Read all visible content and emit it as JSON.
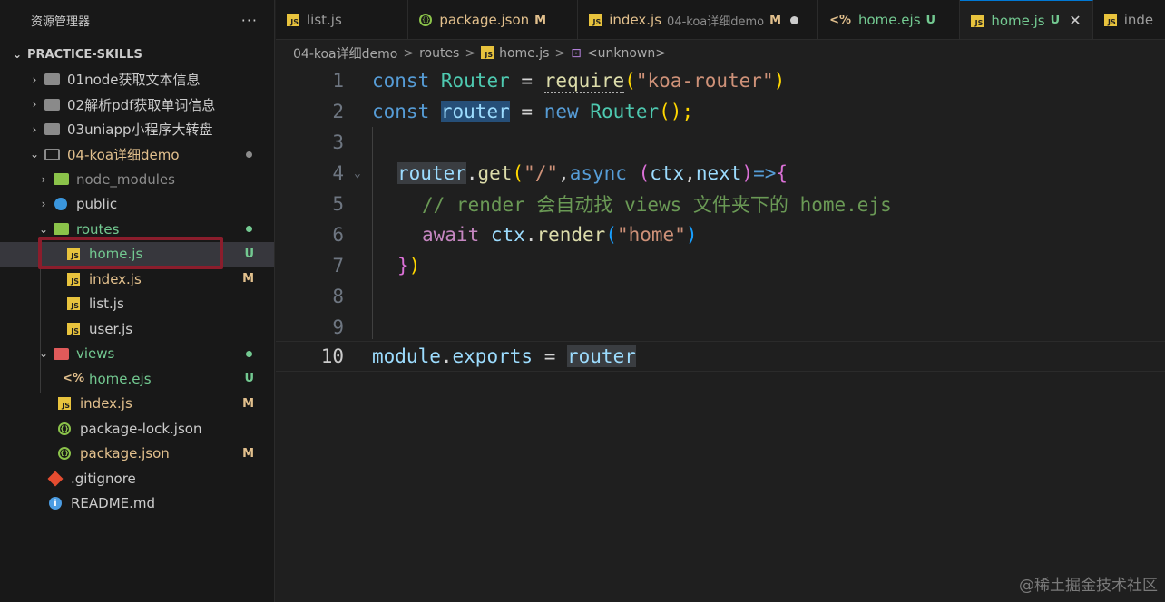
{
  "explorer": {
    "title": "资源管理器",
    "more": "···",
    "root": "PRACTICE-SKILLS",
    "items": [
      {
        "label": "01node获取文本信息"
      },
      {
        "label": "02解析pdf获取单词信息"
      },
      {
        "label": "03uniapp小程序大转盘"
      },
      {
        "label": "04-koa详细demo"
      },
      {
        "label": "node_modules"
      },
      {
        "label": "public"
      },
      {
        "label": "routes"
      },
      {
        "label": "home.js",
        "status": "U"
      },
      {
        "label": "index.js",
        "status": "M"
      },
      {
        "label": "list.js"
      },
      {
        "label": "user.js"
      },
      {
        "label": "views"
      },
      {
        "label": "home.ejs",
        "status": "U"
      },
      {
        "label": "index.js",
        "status": "M"
      },
      {
        "label": "package-lock.json"
      },
      {
        "label": "package.json",
        "status": "M"
      },
      {
        "label": ".gitignore"
      },
      {
        "label": "README.md"
      }
    ]
  },
  "tabs": [
    {
      "label": "list.js",
      "icon": "JS"
    },
    {
      "label": "package.json",
      "status": "M"
    },
    {
      "label": "index.js",
      "sub": "04-koa详细demo",
      "status": "M"
    },
    {
      "label": "home.ejs",
      "status": "U",
      "icon": "<%"
    },
    {
      "label": "home.js",
      "status": "U",
      "close": "✕",
      "icon": "JS"
    },
    {
      "label": "inde",
      "icon": "JS"
    }
  ],
  "breadcrumb": {
    "folder": "04-koa详细demo",
    "sub": "routes",
    "file": "home.js",
    "symbol": "<unknown>",
    "sep": ">"
  },
  "editor": {
    "line_numbers": [
      "1",
      "2",
      "3",
      "4",
      "5",
      "6",
      "7",
      "8",
      "9",
      "10"
    ],
    "tokens": {
      "const": "const",
      "Router": "Router",
      "eq": "=",
      "require": "require",
      "lp": "(",
      "rp": ")",
      "koa_router": "\"koa-router\"",
      "router": "router",
      "new": "new",
      "call_end": "();",
      "dot": ".",
      "get": "get",
      "slash": "\"/\"",
      "comma": ",",
      "async": "async",
      "ctx": "ctx",
      "next": "next",
      "arrow": "=>",
      "lbrace": "{",
      "comment": "// render 会自动找 views 文件夹下的 home.ejs",
      "await": "await",
      "render": "render",
      "home": "\"home\"",
      "close": "})",
      "module": "module",
      "exports": "exports"
    }
  },
  "watermark": "@稀土掘金技术社区",
  "colors": {
    "accent": "#0078d4",
    "modified": "#e2c08d",
    "untracked": "#73c991",
    "highlight_border": "#8b1d2c"
  }
}
